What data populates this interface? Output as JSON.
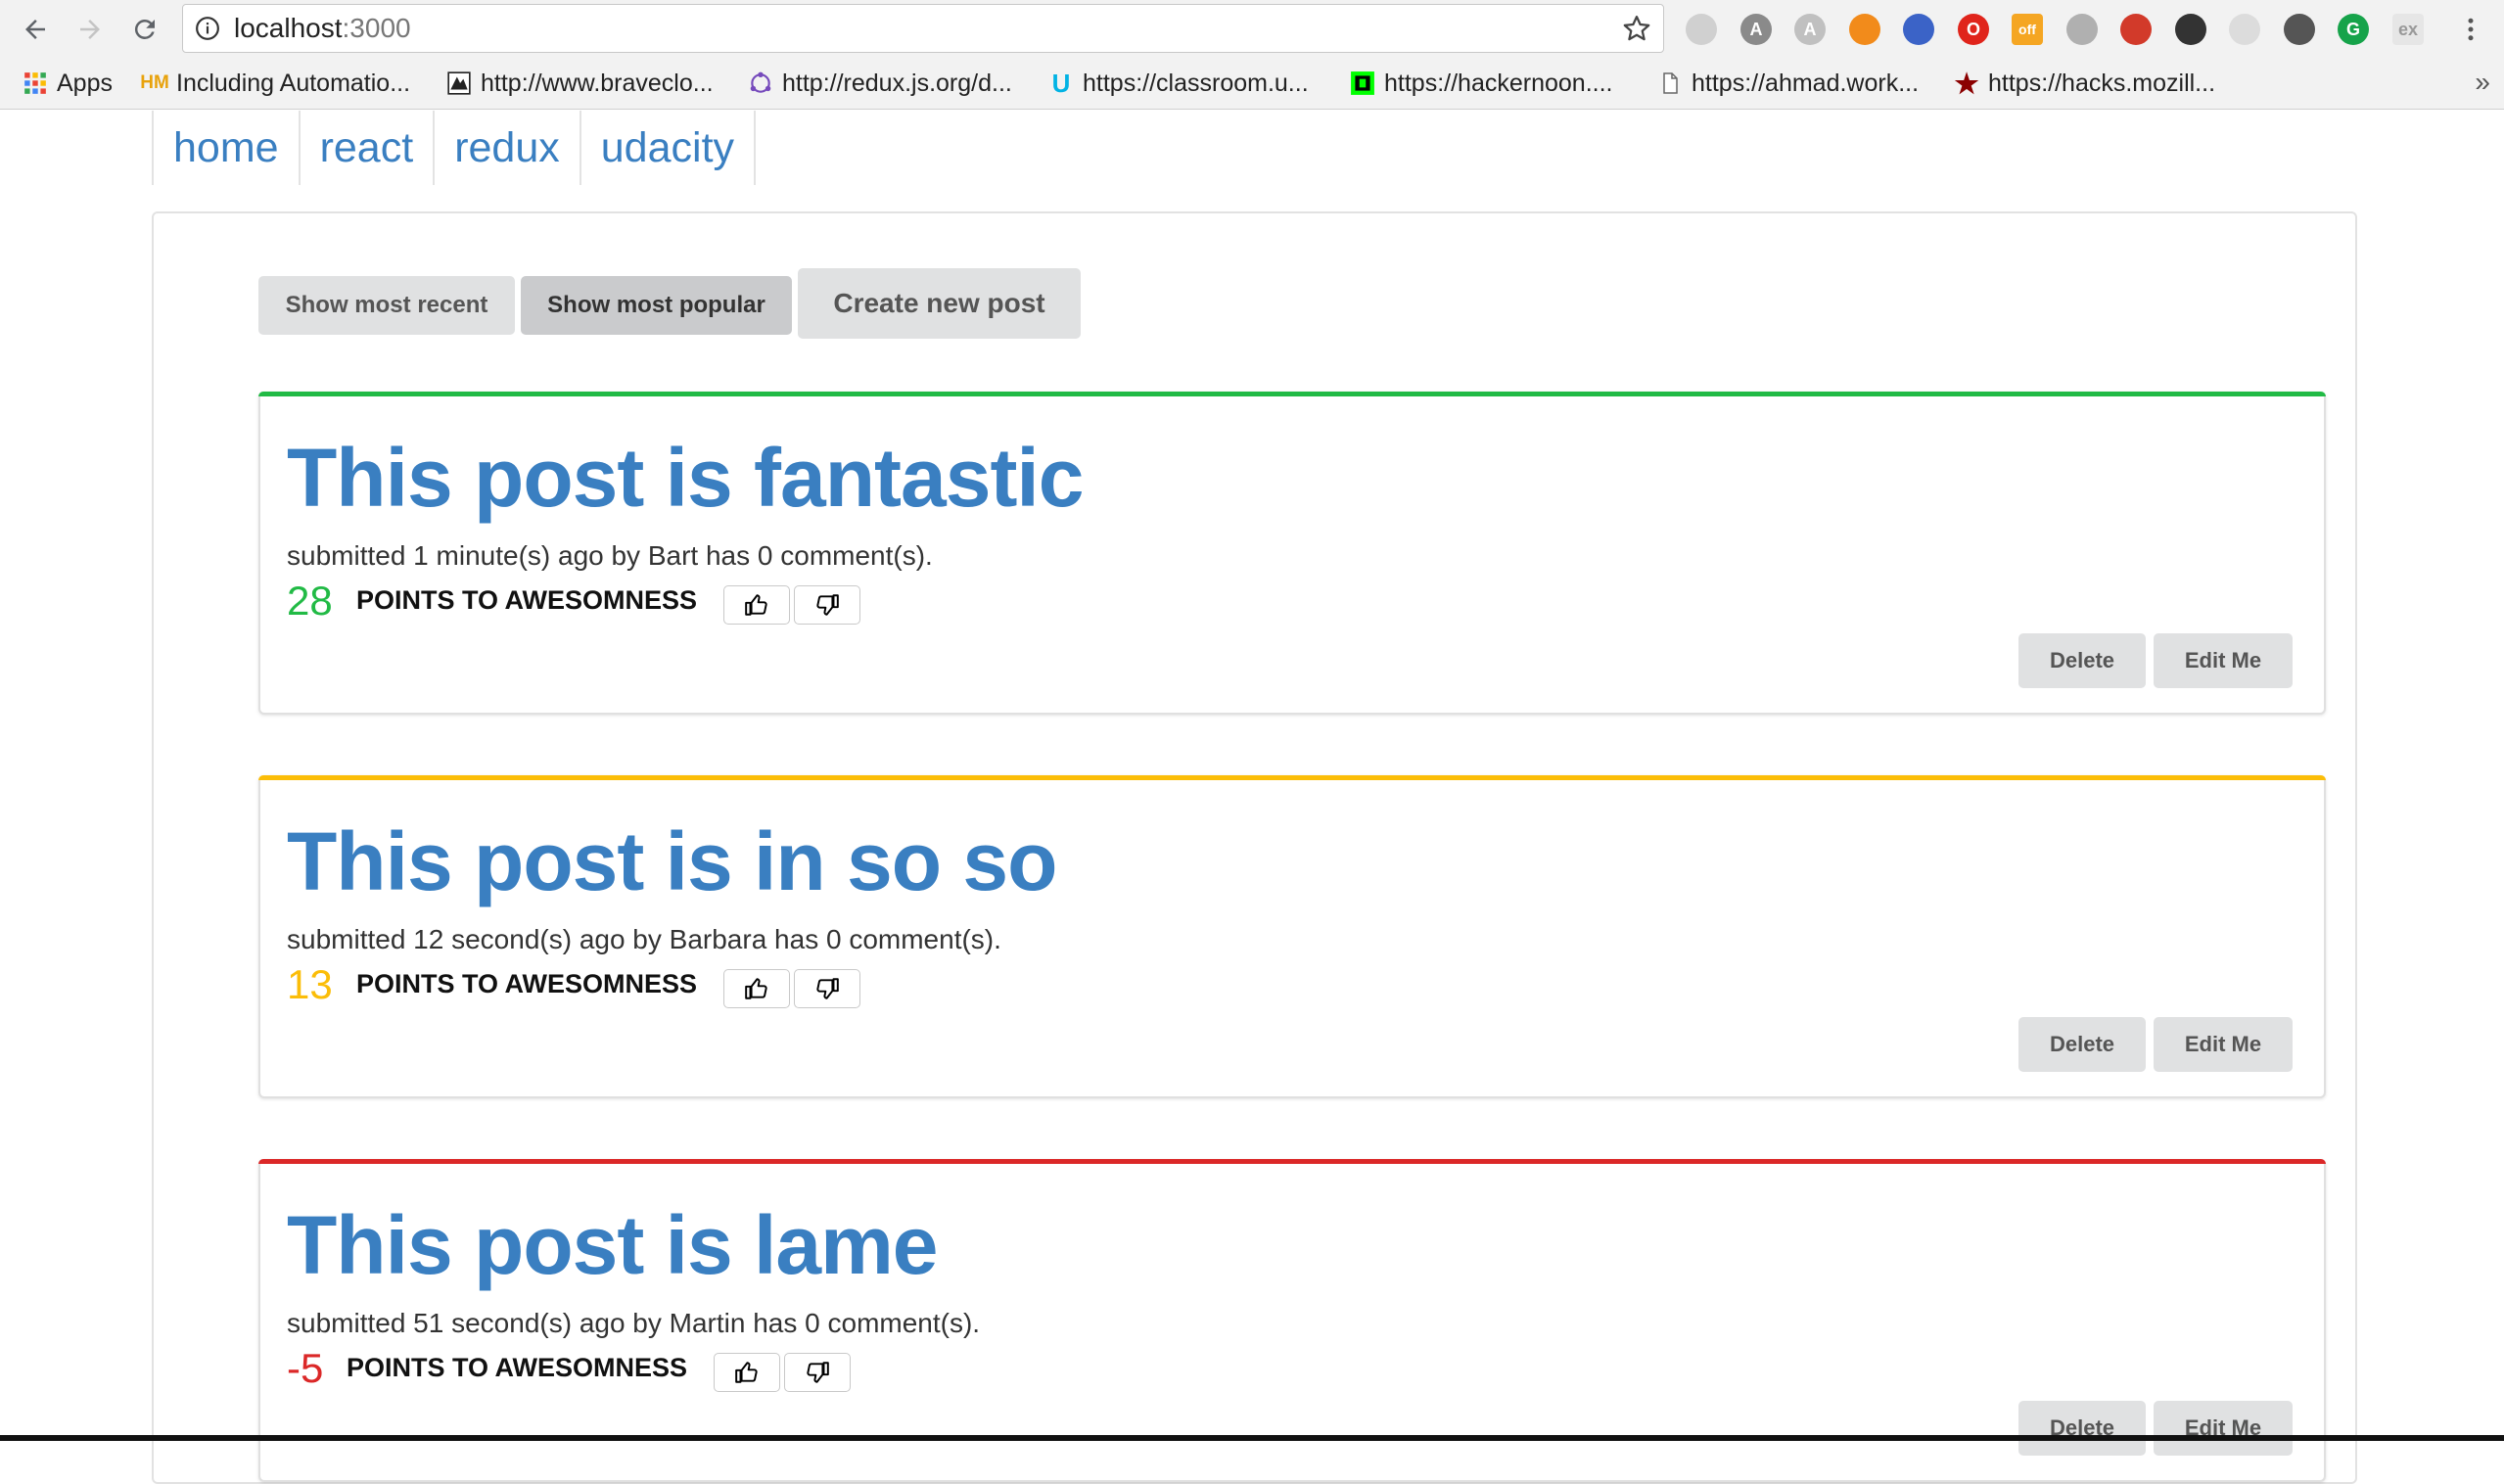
{
  "browser": {
    "url_host": "localhost",
    "url_port": ":3000",
    "extensions": [
      {
        "icon": "extension-icon",
        "glyph": "",
        "color": "#d0d0d0"
      },
      {
        "icon": "angular-icon",
        "glyph": "A",
        "color": "#8a8a8a"
      },
      {
        "icon": "angular-light-icon",
        "glyph": "A",
        "color": "#c0c0c0"
      },
      {
        "icon": "orange-extension-icon",
        "glyph": "",
        "color": "#f28b1b"
      },
      {
        "icon": "block-icon",
        "glyph": "",
        "color": "#3b63c7"
      },
      {
        "icon": "opera-icon",
        "glyph": "O",
        "color": "#e0241b"
      },
      {
        "icon": "honey-off-icon",
        "glyph": "off",
        "color": "#f5a623"
      },
      {
        "icon": "drive-icon",
        "glyph": "",
        "color": "#b0b0b0"
      },
      {
        "icon": "redux-devtools-icon",
        "glyph": "",
        "color": "#d23a2a"
      },
      {
        "icon": "evernote-icon",
        "glyph": "",
        "color": "#333333"
      },
      {
        "icon": "circle-extension-icon",
        "glyph": "",
        "color": "#dcdcdc"
      },
      {
        "icon": "tomato-icon",
        "glyph": "",
        "color": "#555555"
      },
      {
        "icon": "grammarly-icon",
        "glyph": "G",
        "color": "#16a34a"
      },
      {
        "icon": "ex-icon",
        "glyph": "ex",
        "color": "#e6e6e6"
      }
    ],
    "bookmarks": [
      {
        "label": "Apps",
        "icon": "apps-grid-icon"
      },
      {
        "label": "Including Automatio...",
        "icon": "hm-icon",
        "glyph": "HM"
      },
      {
        "label": "http://www.braveclo...",
        "icon": "brave-icon"
      },
      {
        "label": "http://redux.js.org/d...",
        "icon": "redux-icon"
      },
      {
        "label": "https://classroom.u...",
        "icon": "udacity-icon",
        "glyph": "U"
      },
      {
        "label": "https://hackernoon....",
        "icon": "hackernoon-icon"
      },
      {
        "label": "https://ahmad.work...",
        "icon": "page-icon"
      },
      {
        "label": "https://hacks.mozill...",
        "icon": "star-bookmark-icon",
        "glyph": "★"
      }
    ],
    "more": "»"
  },
  "nav": {
    "items": [
      "home",
      "react",
      "redux",
      "udacity"
    ]
  },
  "filters": {
    "recent": "Show most recent",
    "popular": "Show most popular",
    "create": "Create new post"
  },
  "posts": [
    {
      "title": "This post is fantastic",
      "meta": "submitted 1 minute(s) ago by Bart has 0 comment(s).",
      "score": "28",
      "score_color": "#21ba45",
      "bar_color": "#21ba45",
      "points_label": "POINTS TO AWESOMNESS",
      "delete": "Delete",
      "edit": "Edit Me"
    },
    {
      "title": "This post is in so so",
      "meta": "submitted 12 second(s) ago by Barbara has 0 comment(s).",
      "score": "13",
      "score_color": "#fbbd08",
      "bar_color": "#fbbd08",
      "points_label": "POINTS TO AWESOMNESS",
      "delete": "Delete",
      "edit": "Edit Me"
    },
    {
      "title": "This post is lame",
      "meta": "submitted 51 second(s) ago by Martin has 0 comment(s).",
      "score": "-5",
      "score_color": "#db2828",
      "bar_color": "#db2828",
      "points_label": "POINTS TO AWESOMNESS",
      "delete": "Delete",
      "edit": "Edit Me"
    }
  ]
}
